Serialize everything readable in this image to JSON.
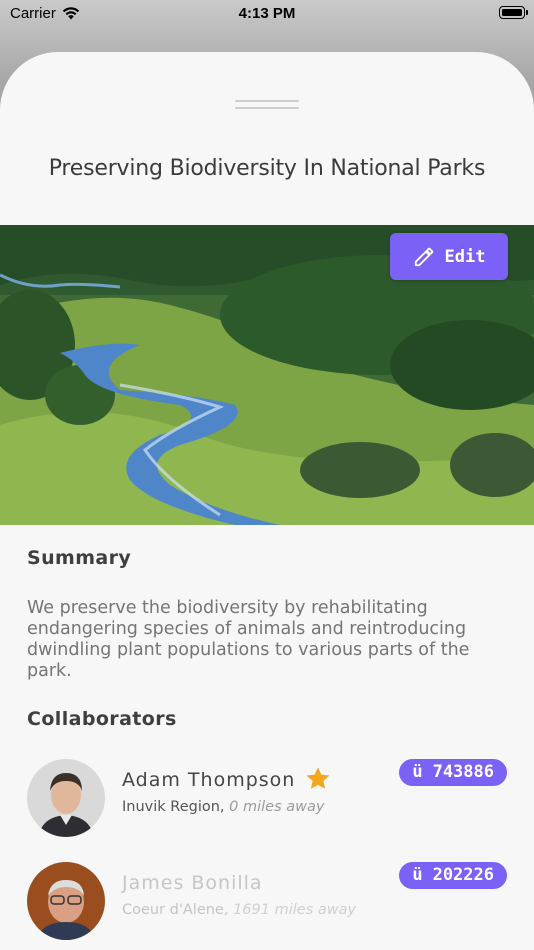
{
  "status_bar": {
    "carrier": "Carrier",
    "time": "4:13 PM"
  },
  "sheet": {
    "title": "Preserving Biodiversity In National Parks",
    "edit_label": "Edit",
    "summary_heading": "Summary",
    "summary_text": "We preserve the biodiversity by rehabilitating endangering species of animals and reintroducing dwindling plant populations to various parts of the park.",
    "collaborators_heading": "Collaborators"
  },
  "collaborators": [
    {
      "name": "Adam Thompson",
      "region": "Inuvik Region,",
      "distance": "0 miles away",
      "badge_icon": "ü",
      "badge_value": "743886",
      "starred": true
    },
    {
      "name": "James Bonilla",
      "region": "Coeur d'Alene,",
      "distance": "1691 miles away",
      "badge_icon": "ü",
      "badge_value": "202226",
      "starred": false
    }
  ],
  "colors": {
    "accent": "#7b61f5",
    "star": "#f2a71f"
  }
}
